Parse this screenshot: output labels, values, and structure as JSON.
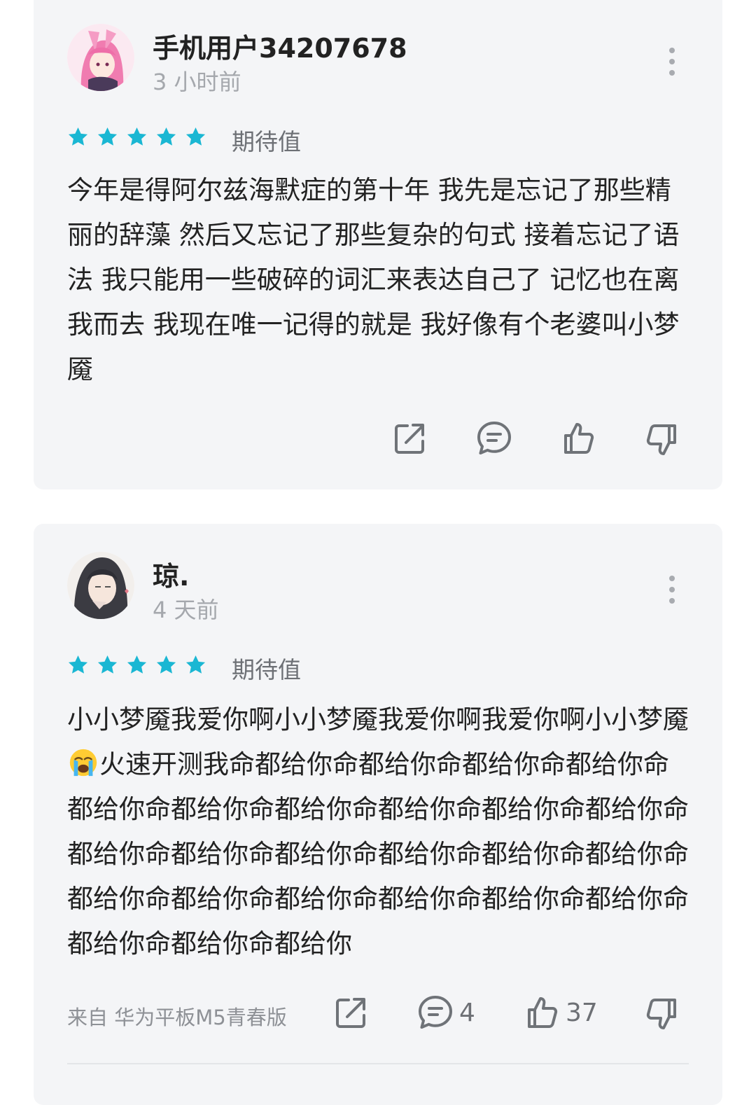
{
  "reviews": [
    {
      "username": "手机用户34207678",
      "time": "3 小时前",
      "rating_label": "期待值",
      "rating": 5,
      "content": "今年是得阿尔兹海默症的第十年 我先是忘记了那些精丽的辞藻 然后又忘记了那些复杂的句式 接着忘记了语法 我只能用一些破碎的词汇来表达自己了 记忆也在离我而去 我现在唯一记得的就是 我好像有个老婆叫小梦魇",
      "actions": {
        "share_icon": "share-icon",
        "comment_icon": "comment-icon",
        "like_icon": "thumbs-up-icon",
        "dislike_icon": "thumbs-down-icon"
      }
    },
    {
      "username": "琼.",
      "time": "4 天前",
      "rating_label": "期待值",
      "rating": 5,
      "content_before_emoji": "小小梦魇我爱你啊小小梦魇我爱你啊我爱你啊小小梦魇",
      "emoji": "loudly-crying-face",
      "content_after_emoji": "火速开测我命都给你命都给你命都给你命都给你命都给你命都给你命都给你命都给你命都给你命都给你命都给你命都给你命都给你命都给你命都给你命都给你命都给你命都给你命都给你命都给你命都给你命都给你命都给你命都给你命都给你",
      "device": "来自 华为平板M5青春版",
      "comment_count": "4",
      "like_count": "37"
    }
  ],
  "colors": {
    "star": "#1ab7d3",
    "icon": "#6f7378",
    "card_bg": "#f4f5f7"
  }
}
